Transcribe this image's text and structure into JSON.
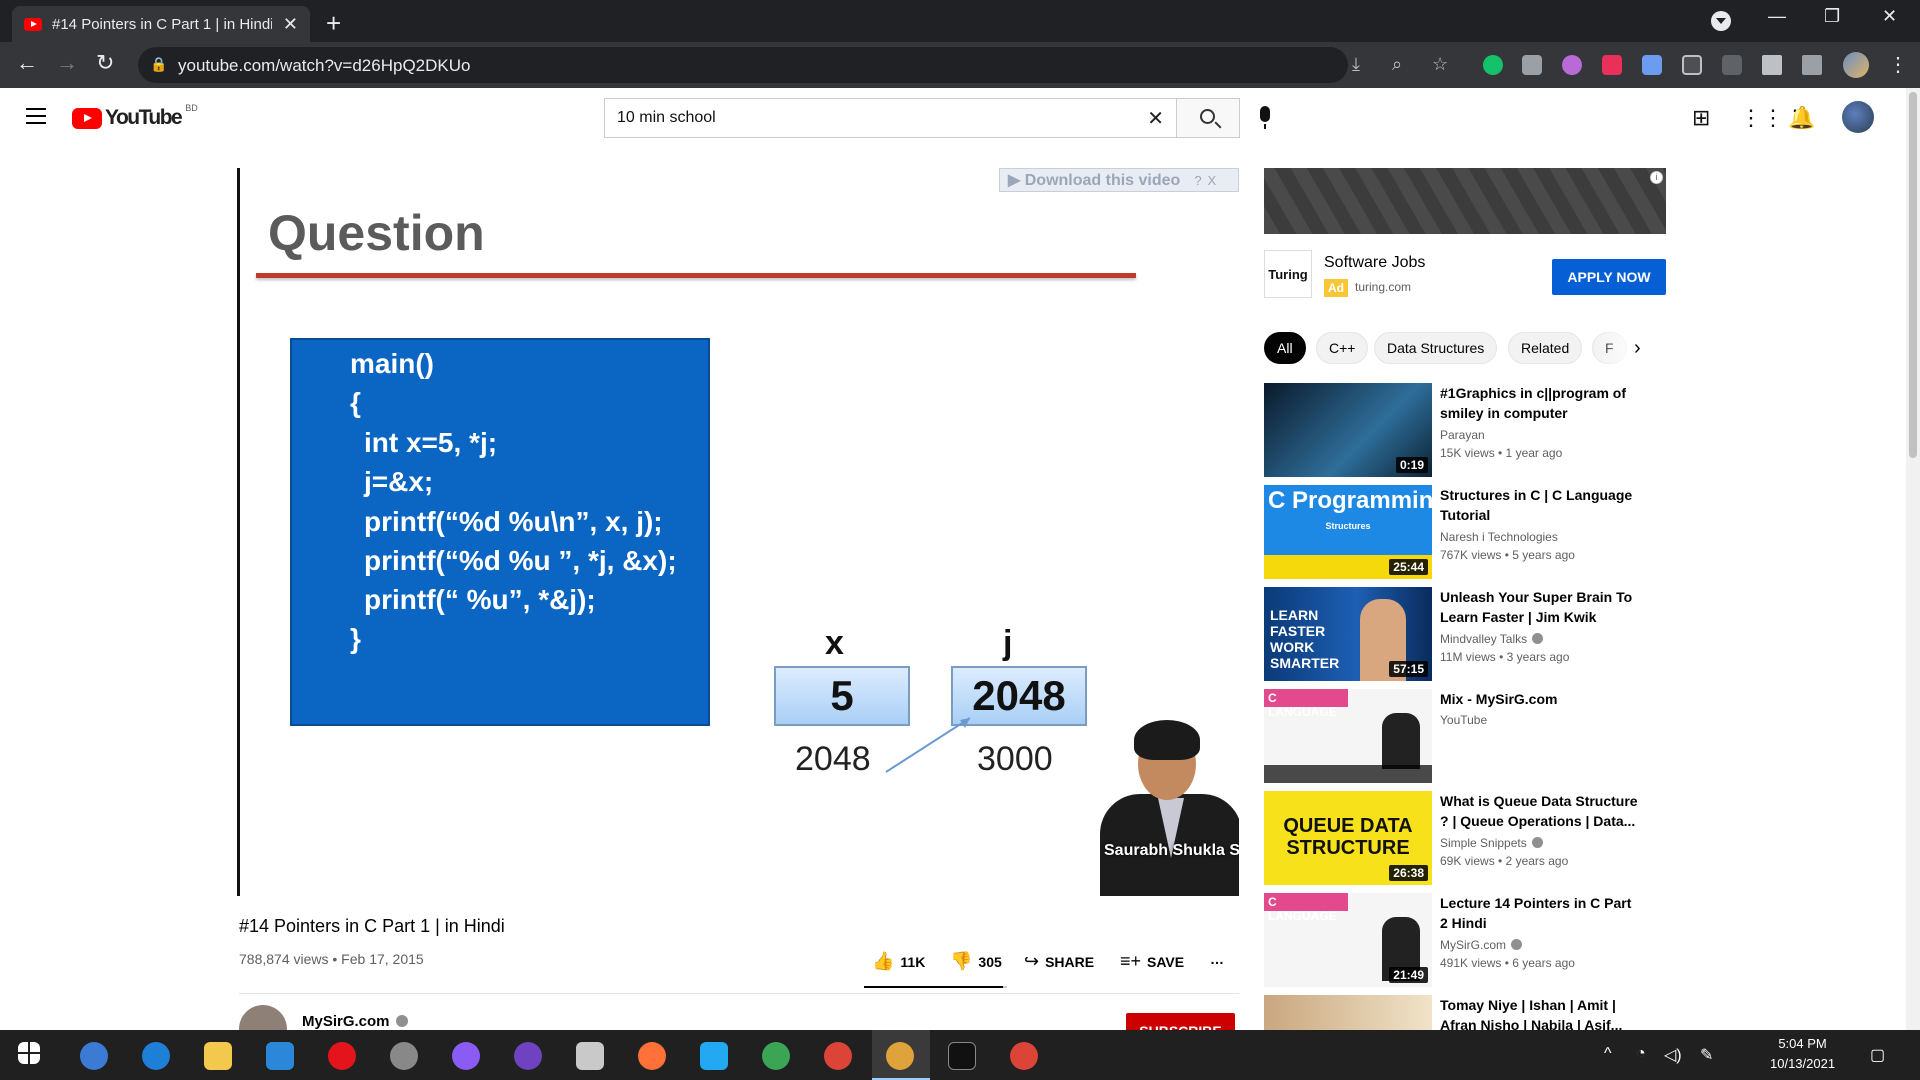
{
  "browser": {
    "tab_title": "#14 Pointers in C Part 1 | in Hindi",
    "tab_close": "✕",
    "new_tab": "+",
    "url": "youtube.com/watch?v=d26HpQ2DKUo"
  },
  "youtube": {
    "logo_text": "YouTube",
    "country_code": "BD",
    "search_value": "10 min school",
    "clear_search": "✕"
  },
  "video": {
    "download_label": "▶ Download this video",
    "download_help": "?",
    "download_close": "X",
    "slide_title": "Question",
    "code_lines": [
      "main()",
      "{",
      "int x=5, *j;",
      "j=&x;",
      "printf(“%d %u\\n”, x, j);",
      "printf(“%d %u ”, *j, &x);",
      "printf(“ %u”, *&j);",
      "}"
    ],
    "var_x": "x",
    "var_j": "j",
    "value_x": "5",
    "value_j": "2048",
    "addr_x": "2048",
    "addr_j": "3000",
    "presenter_name": "Saurabh Shukla Sir",
    "title": "#14 Pointers in C Part 1 | in Hindi",
    "meta": "788,874 views • Feb 17, 2015",
    "like_count": "11K",
    "dislike_count": "305",
    "like_ratio": 0.97,
    "share_label": "SHARE",
    "save_label": "SAVE",
    "more_label": "…",
    "channel_name": "MySirG.com",
    "subscribe_label": "SUBSCRIBE"
  },
  "ad": {
    "logo_text": "Turing",
    "title": "Software Jobs",
    "badge": "Ad",
    "domain": "turing.com",
    "cta": "APPLY NOW"
  },
  "chips": [
    "All",
    "C++",
    "Data Structures",
    "Related",
    "F"
  ],
  "recommendations": [
    {
      "title": "#1Graphics in c||program of smiley in computer graphics...",
      "channel": "Parayan",
      "meta": "15K views • 1 year ago",
      "duration": "0:19",
      "verified": false
    },
    {
      "title": "Structures in C | C Language Tutorial",
      "channel": "Naresh i Technologies",
      "meta": "767K views • 5 years ago",
      "duration": "25:44",
      "verified": false,
      "thumb_text": "C Programming",
      "thumb_sub": "Structures"
    },
    {
      "title": "Unleash Your Super Brain To Learn Faster | Jim Kwik",
      "channel": "Mindvalley Talks",
      "meta": "11M views • 3 years ago",
      "duration": "57:15",
      "verified": true,
      "thumb_text": "LEARN FASTER WORK SMARTER"
    },
    {
      "title": "Mix - MySirG.com",
      "channel": "YouTube",
      "meta": "",
      "duration": "",
      "verified": false,
      "thumb_text": "C LANGUAGE"
    },
    {
      "title": "What is Queue Data Structure ? | Queue Operations | Data...",
      "channel": "Simple Snippets",
      "meta": "69K views • 2 years ago",
      "duration": "26:38",
      "verified": true,
      "thumb_text": "QUEUE DATA STRUCTURE"
    },
    {
      "title": "Lecture 14 Pointers in C Part 2 Hindi",
      "channel": "MySirG.com",
      "meta": "491K views • 6 years ago",
      "duration": "21:49",
      "verified": true,
      "thumb_text": "C LANGUAGE"
    },
    {
      "title": "Tomay Niye | Ishan | Amit | Afran Nisho | Nabila | Asif...",
      "channel": "",
      "meta": "",
      "duration": "",
      "verified": false
    }
  ],
  "taskbar": {
    "time": "5:04 PM",
    "date": "10/13/2021"
  },
  "colors": {
    "yt_red": "#ff0000",
    "slide_blue": "#0b66c3",
    "apply_blue": "#065fd4",
    "subscribe_red": "#cc0000"
  }
}
